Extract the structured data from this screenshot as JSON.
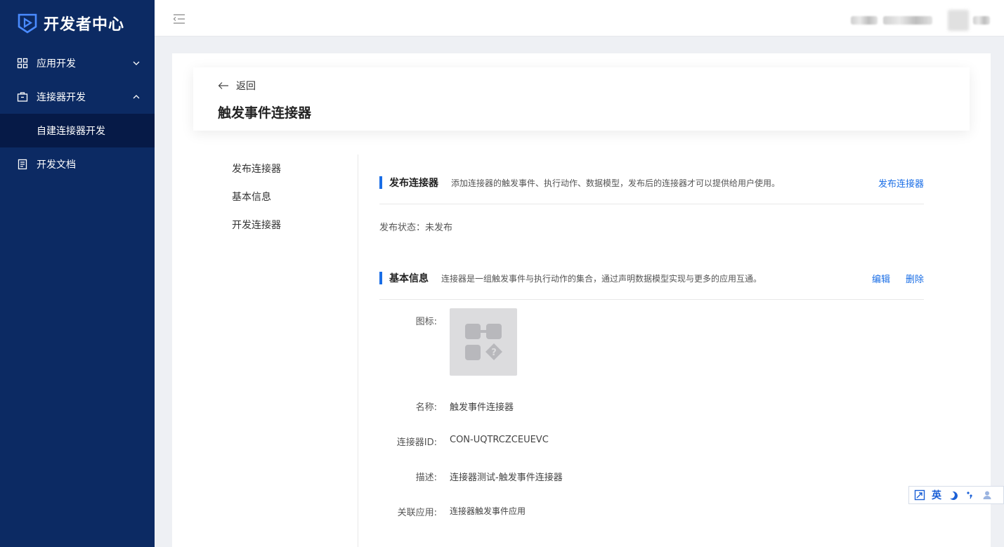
{
  "brand": {
    "name": "开发者中心"
  },
  "sidebar": {
    "items": [
      {
        "label": "应用开发"
      },
      {
        "label": "连接器开发"
      },
      {
        "label": "自建连接器开发"
      },
      {
        "label": "开发文档"
      }
    ]
  },
  "header": {
    "back_label": "返回",
    "title": "触发事件连接器"
  },
  "left_nav": {
    "items": [
      "发布连接器",
      "基本信息",
      "开发连接器"
    ]
  },
  "publish": {
    "title": "发布连接器",
    "desc": "添加连接器的触发事件、执行动作、数据模型，发布后的连接器才可以提供给用户使用。",
    "action_label": "发布连接器",
    "status_text": "发布状态：未发布"
  },
  "basic": {
    "title": "基本信息",
    "desc": "连接器是一组触发事件与执行动作的集合，通过声明数据模型实现与更多的应用互通。",
    "edit_label": "编辑",
    "delete_label": "删除",
    "fields": {
      "icon_label": "图标:",
      "name_label": "名称:",
      "name_value": "触发事件连接器",
      "id_label": "连接器ID:",
      "id_value": "CON-UQTRCZCEUEVC",
      "desc_label": "描述:",
      "desc_value": "连接器测试-触发事件连接器",
      "app_label": "关联应用:",
      "app_value": "连接器触发事件应用"
    }
  },
  "ime": {
    "lang_label": "英"
  },
  "colors": {
    "sidebar_bg": "#0c2a63",
    "sidebar_sub_bg": "#061a47",
    "accent": "#1a6ee6"
  }
}
